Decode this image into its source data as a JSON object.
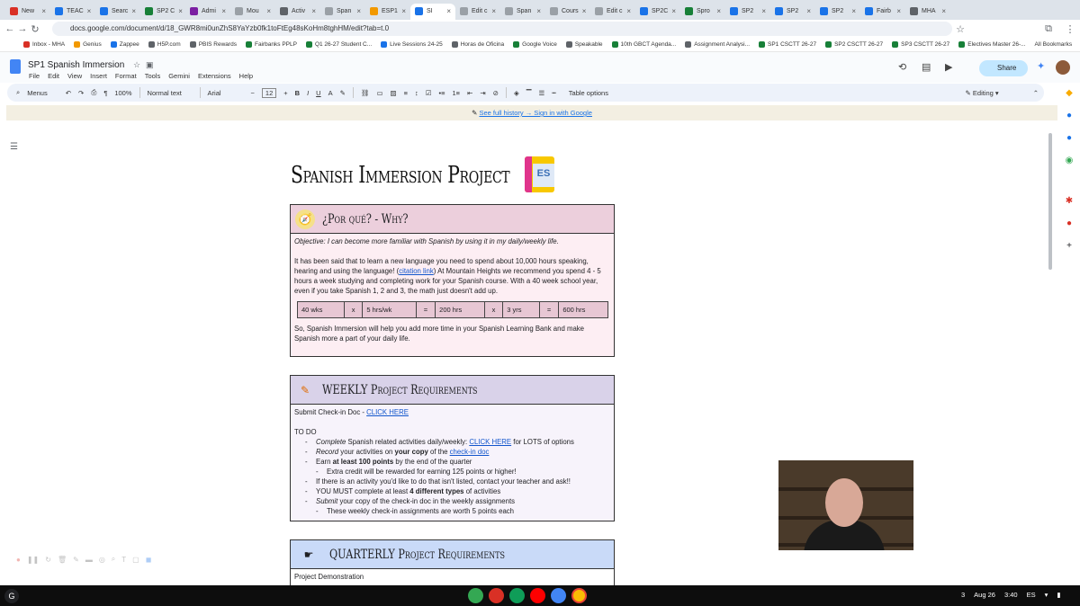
{
  "browser": {
    "tabs": [
      {
        "label": "New",
        "color": "#d93025"
      },
      {
        "label": "TEAC",
        "color": "#1a73e8"
      },
      {
        "label": "Searc",
        "color": "#1a73e8"
      },
      {
        "label": "SP2 C",
        "color": "#188038"
      },
      {
        "label": "Admi",
        "color": "#7b1fa2"
      },
      {
        "label": "Mou",
        "color": "#9aa0a6"
      },
      {
        "label": "Activ",
        "color": "#5f6368"
      },
      {
        "label": "Span",
        "color": "#9aa0a6"
      },
      {
        "label": "ESP1",
        "color": "#f29900"
      },
      {
        "label": "SI",
        "color": "#1a73e8",
        "active": true
      },
      {
        "label": "Edit c",
        "color": "#9aa0a6"
      },
      {
        "label": "Span",
        "color": "#9aa0a6"
      },
      {
        "label": "Cours",
        "color": "#9aa0a6"
      },
      {
        "label": "Edit c",
        "color": "#9aa0a6"
      },
      {
        "label": "SP2C",
        "color": "#1a73e8"
      },
      {
        "label": "Spro",
        "color": "#188038"
      },
      {
        "label": "SP2",
        "color": "#1a73e8"
      },
      {
        "label": "SP2",
        "color": "#1a73e8"
      },
      {
        "label": "SP2",
        "color": "#1a73e8"
      },
      {
        "label": "Fairb",
        "color": "#1a73e8"
      },
      {
        "label": "MHA",
        "color": "#5f6368"
      }
    ],
    "url": "docs.google.com/document/d/18_GWR8mi0unZhS8YaYzb0fk1toFtEg48sKoHm8tghHM/edit?tab=t.0",
    "bookmarks": [
      {
        "label": "Inbox - MHA",
        "color": "#d93025"
      },
      {
        "label": "Genius",
        "color": "#f29900"
      },
      {
        "label": "Zappee",
        "color": "#1a73e8"
      },
      {
        "label": "H5P.com",
        "color": "#5f6368"
      },
      {
        "label": "PBIS Rewards",
        "color": "#5f6368"
      },
      {
        "label": "Fairbanks PPLP",
        "color": "#188038"
      },
      {
        "label": "Q1 26-27 Student C...",
        "color": "#188038"
      },
      {
        "label": "Live Sessions 24-25",
        "color": "#1a73e8"
      },
      {
        "label": "Horas de Oficina",
        "color": "#5f6368"
      },
      {
        "label": "Google Voice",
        "color": "#188038"
      },
      {
        "label": "Speakable",
        "color": "#5f6368"
      },
      {
        "label": "10th GBCT Agenda...",
        "color": "#188038"
      },
      {
        "label": "Assignment Analysi...",
        "color": "#5f6368"
      },
      {
        "label": "SP1 CSCTT 26-27",
        "color": "#188038"
      },
      {
        "label": "SP2 CSCTT 26-27",
        "color": "#188038"
      },
      {
        "label": "SP3 CSCTT 26-27",
        "color": "#188038"
      },
      {
        "label": "Electives Master 26-...",
        "color": "#188038"
      }
    ],
    "all_bookmarks": "All Bookmarks"
  },
  "docs": {
    "title": "SP1 Spanish Immersion",
    "menus": [
      "File",
      "Edit",
      "View",
      "Insert",
      "Format",
      "Tools",
      "Gemini",
      "Extensions",
      "Help"
    ],
    "share_label": "Share",
    "toolbar": {
      "menus": "Menus",
      "zoom": "100%",
      "style": "Normal text",
      "font": "Arial",
      "font_size": "12",
      "table_options": "Table options",
      "mode": "Editing"
    },
    "banner_link": "See full history → Sign in with Google"
  },
  "document": {
    "title": "Spanish Immersion Project",
    "badge": "ES",
    "section1": {
      "heading": "¿Por qué? - Why?",
      "objective": "Objective: I can become more familiar with Spanish by using it in my daily/weekly life.",
      "para_a": "It has been said that to learn a new language you need to spend about 10,000 hours speaking, hearing and using the language! (",
      "link": "citation link",
      "para_b": ")  At Mountain Heights we recommend you spend 4 - 5 hours a week studying and completing work for your Spanish course.  With a 40 week school year, even if you take Spanish 1, 2 and 3, the math just doesn't add up.",
      "calc": [
        "40 wks",
        "x",
        "5 hrs/wk",
        "=",
        "200 hrs",
        "x",
        "3 yrs",
        "=",
        "600 hrs"
      ],
      "closing": "So, Spanish Immersion will help you add more time in your Spanish Learning Bank and make Spanish more a part of your daily life."
    },
    "section2": {
      "heading": "WEEKLY Project Requirements",
      "submit": "Submit Check-in Doc - ",
      "submit_link": "CLICK HERE",
      "todo": "TO DO",
      "i1_em": "Complete",
      "i1_text": " Spanish related activities daily/weekly: ",
      "i1_link": "CLICK HERE",
      "i1_tail": " for LOTS of options",
      "i2_em": "Record",
      "i2_text": " your activities on ",
      "i2_bold": "your copy",
      "i2_mid": " of the ",
      "i2_link": "check-in doc",
      "i3_text": "Earn ",
      "i3_bold": "at least 100 points",
      "i3_tail": " by the end of the quarter",
      "i4": "Extra credit will be rewarded for earning 125 points or higher!",
      "i5": "If there is an activity you'd like to do that isn't listed, contact your teacher and ask!!",
      "i6_text": "YOU MUST complete at least ",
      "i6_bold": "4 different types",
      "i6_tail": " of activities",
      "i7_em": "Submit",
      "i7_text": " your copy of the check-in doc in the weekly assignments",
      "i8": "These weekly check-in assignments are worth 5 points each"
    },
    "section3": {
      "heading": "QUARTERLY Project Requirements",
      "first_line": "Project Demonstration"
    }
  },
  "taskbar": {
    "date": "Aug 26",
    "time": "3:40",
    "lang": "ES",
    "notif": "3"
  }
}
